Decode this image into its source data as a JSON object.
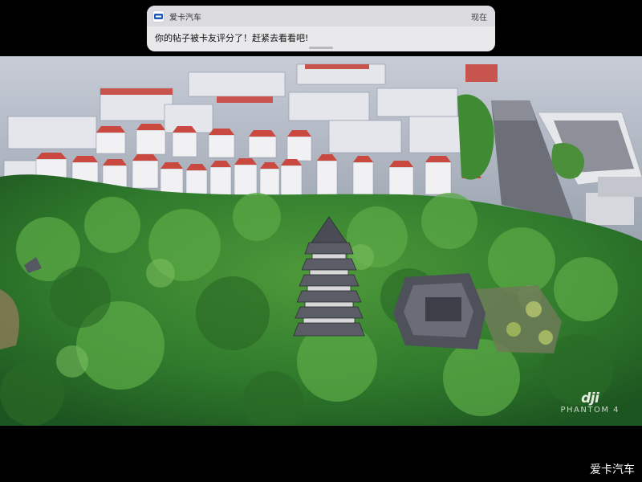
{
  "notification": {
    "app_icon": "aika-app-icon",
    "app_name": "爱卡汽车",
    "time": "现在",
    "message": "你的帖子被卡友评分了！赶紧去看看吧!"
  },
  "video": {
    "overlay_logo": "dji",
    "overlay_product": "PHANTOM 4"
  },
  "watermark": "爱卡汽车"
}
